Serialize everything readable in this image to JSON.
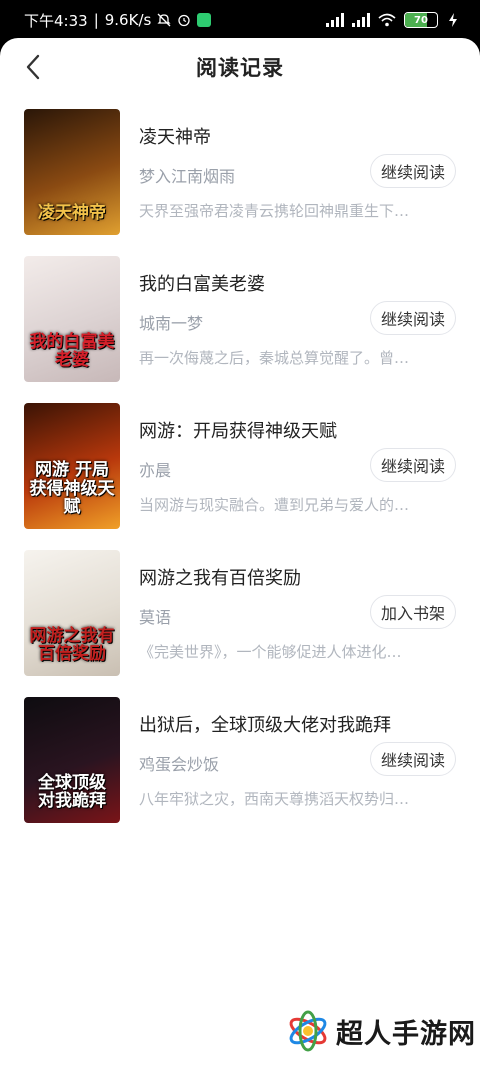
{
  "status_bar": {
    "time": "下午4:33",
    "separator": "|",
    "speed": "9.6K/s",
    "battery": "70",
    "battery_level_pct": 70
  },
  "header": {
    "title": "阅读记录",
    "back_icon": "chevron-left-icon"
  },
  "books": [
    {
      "title": "凌天神帝",
      "author": "梦入江南烟雨",
      "button": "继续阅读",
      "desc": "天界至强帝君凌青云携轮回神鼎重生下…",
      "cover_text": "凌天神帝",
      "cover_colors": [
        "#2a1608",
        "#8a4a12",
        "#e0a030"
      ],
      "cover_text_color": "#f2c24a"
    },
    {
      "title": "我的白富美老婆",
      "author": "城南一梦",
      "button": "继续阅读",
      "desc": "再一次侮蔑之后，秦城总算觉醒了。曾…",
      "cover_text": "我的白富美老婆",
      "cover_colors": [
        "#f3ecea",
        "#dcd2d2",
        "#c7b8b8"
      ],
      "cover_text_color": "#d6202a"
    },
    {
      "title": "网游：开局获得神级天赋",
      "author": "亦晨",
      "button": "继续阅读",
      "desc": "当网游与现实融合。遭到兄弟与爱人的…",
      "cover_text": "网游 开局获得神级天赋",
      "cover_colors": [
        "#3a1305",
        "#b8380c",
        "#f0a028"
      ],
      "cover_text_color": "#ffffff"
    },
    {
      "title": "网游之我有百倍奖励",
      "author": "莫语",
      "button": "加入书架",
      "desc": "《完美世界》，一个能够促进人体进化…",
      "cover_text": "网游之我有百倍奖励",
      "cover_colors": [
        "#f6f3ee",
        "#e3ddd3",
        "#c9bfb2"
      ],
      "cover_text_color": "#c3201f"
    },
    {
      "title": "出狱后，全球顶级大佬对我跪拜",
      "author": "鸡蛋会炒饭",
      "button": "继续阅读",
      "desc": "八年牢狱之灾，西南天尊携滔天权势归…",
      "cover_text": "全球顶级 对我跪拜",
      "cover_colors": [
        "#0e0c10",
        "#2a1420",
        "#7a1418"
      ],
      "cover_text_color": "#ffffff"
    }
  ],
  "watermark": {
    "text": "超人手游网",
    "logo_icon": "colorful-atom-logo-icon"
  }
}
